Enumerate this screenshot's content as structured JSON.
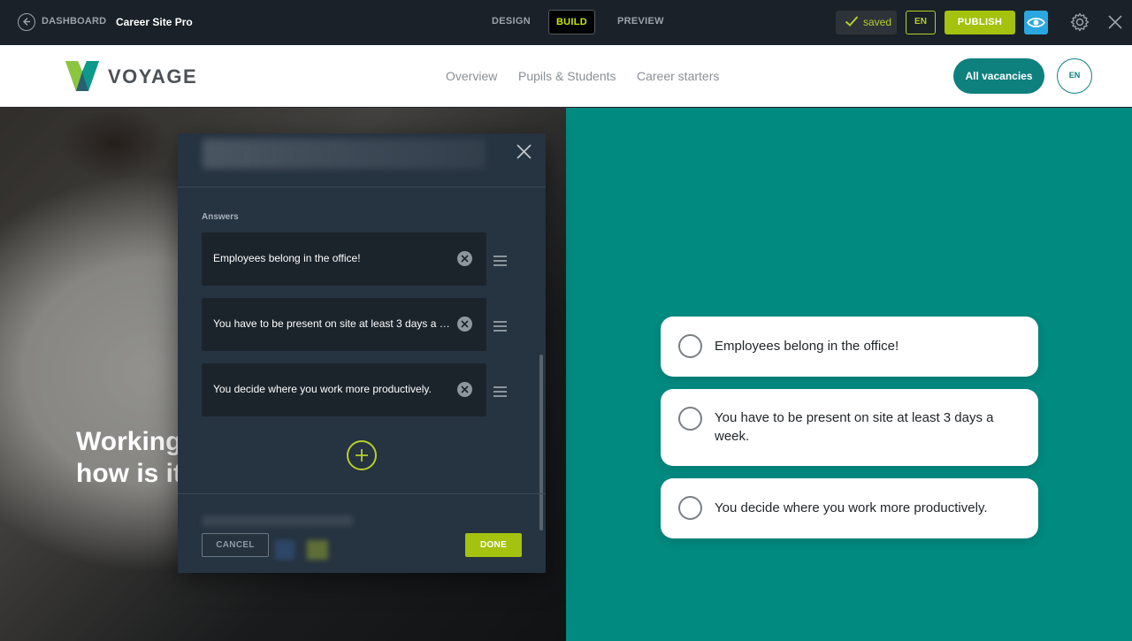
{
  "topbar": {
    "back_label": "DASHBOARD",
    "site_name": "Career Site Pro",
    "tabs": [
      {
        "label": "DESIGN",
        "active": false
      },
      {
        "label": "BUILD",
        "active": true
      },
      {
        "label": "PREVIEW",
        "active": false
      }
    ],
    "saved_label": "saved",
    "lang": "EN",
    "publish_label": "PUBLISH",
    "icons": [
      "back-arrow-icon",
      "check-icon",
      "eye-icon",
      "gear-icon",
      "close-icon"
    ]
  },
  "site_header": {
    "logo_text": "VOYAGE",
    "nav": [
      "Overview",
      "Pupils & Students",
      "Career starters"
    ],
    "cta_label": "All vacancies",
    "lang": "EN"
  },
  "hero": {
    "title_lines": [
      "Working",
      "how is it"
    ],
    "accent_color": "#008a80"
  },
  "answer_cards": [
    {
      "label": "Employees belong in the office!"
    },
    {
      "label": "You have to be present on site at least 3 days a week."
    },
    {
      "label": "You decide where you work more productively."
    }
  ],
  "modal": {
    "section_label": "Answers",
    "answers": [
      {
        "text": "Employees belong in the office!"
      },
      {
        "text": "You have to be present on site at least 3 days a week."
      },
      {
        "text": "You decide where you work more productively."
      }
    ],
    "cancel_label": "CANCEL",
    "done_label": "DONE"
  },
  "colors": {
    "editor_bg": "#1b2128",
    "lime": "#a4c20e",
    "teal": "#0e807e",
    "modal_bg": "#263340"
  }
}
